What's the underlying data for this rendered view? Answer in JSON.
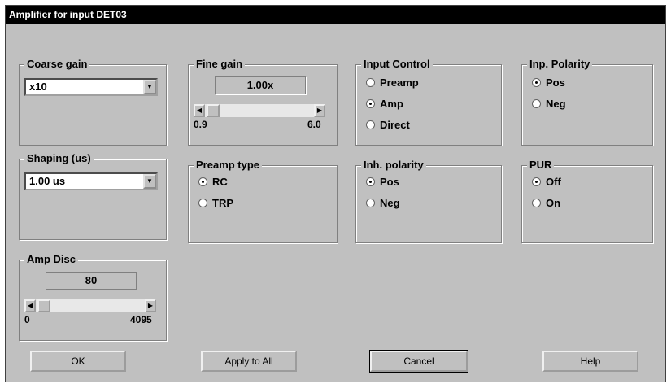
{
  "window": {
    "title": "Amplifier for input DET03"
  },
  "coarse_gain": {
    "label": "Coarse gain",
    "value": "x10"
  },
  "fine_gain": {
    "label": "Fine gain",
    "value": "1.00x",
    "min": "0.9",
    "max": "6.0"
  },
  "input_control": {
    "label": "Input Control",
    "options": [
      "Preamp",
      "Amp",
      "Direct"
    ],
    "selected": "Amp"
  },
  "inp_polarity": {
    "label": "Inp. Polarity",
    "options": [
      "Pos",
      "Neg"
    ],
    "selected": "Pos"
  },
  "shaping": {
    "label": "Shaping (us)",
    "value": "1.00 us"
  },
  "preamp_type": {
    "label": "Preamp type",
    "options": [
      "RC",
      "TRP"
    ],
    "selected": "RC"
  },
  "inh_polarity": {
    "label": "Inh. polarity",
    "options": [
      "Pos",
      "Neg"
    ],
    "selected": "Pos"
  },
  "pur": {
    "label": "PUR",
    "options": [
      "Off",
      "On"
    ],
    "selected": "Off"
  },
  "amp_disc": {
    "label": "Amp Disc",
    "value": "80",
    "min": "0",
    "max": "4095"
  },
  "buttons": {
    "ok": "OK",
    "apply_all": "Apply to All",
    "cancel": "Cancel",
    "help": "Help"
  }
}
